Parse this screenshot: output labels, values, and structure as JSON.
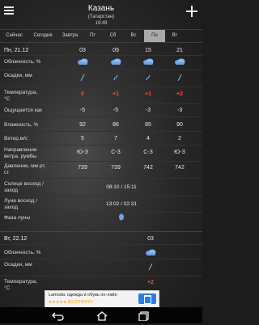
{
  "header": {
    "title": "Казань",
    "subtitle": "(Татарстан)",
    "time": "19:49"
  },
  "tabs": [
    {
      "label": "Сейчас"
    },
    {
      "label": "Сегодня"
    },
    {
      "label": "Завтра"
    },
    {
      "label": "Пт"
    },
    {
      "label": "Сб"
    },
    {
      "label": "Вс"
    },
    {
      "label": "Пн",
      "active": true
    },
    {
      "label": "Вт"
    }
  ],
  "day1": {
    "date": "Пн, 21.12",
    "hours": [
      "03",
      "09",
      "15",
      "21"
    ],
    "labels": {
      "cloudiness": "Облачность, %",
      "precip": "Осадки, мм",
      "temperature": "Температура, °С",
      "feels_like": "Ощущается как",
      "humidity": "Влажность, %",
      "wind": "Ветер,м/с",
      "wind_dir": "Направление ветра, румбы",
      "pressure": "Давление, мм рт. ст.",
      "sun": "Солнце восход / заход",
      "moon": "Луна восход / заход",
      "moon_phase": "Фаза луны"
    },
    "temperature": [
      "0",
      "+1",
      "+1",
      "+2"
    ],
    "feels_like": [
      "-5",
      "-5",
      "-3",
      "-3"
    ],
    "humidity": [
      "92",
      "86",
      "85",
      "90"
    ],
    "wind": [
      "5",
      "7",
      "4",
      "2"
    ],
    "wind_dir": [
      "Ю-З",
      "С-З",
      "С-З",
      "Ю-З"
    ],
    "pressure": [
      "739",
      "739",
      "742",
      "742"
    ],
    "sun": "08:10 / 15:11",
    "moon": "13:02 / 02:31"
  },
  "day2": {
    "date": "Вт, 22.12",
    "hours": [
      "03"
    ],
    "labels": {
      "cloudiness": "Облачность, %",
      "precip": "Осадки, мм",
      "temperature": "Температура, °С"
    },
    "temperature": [
      "+2"
    ]
  },
  "ad": {
    "text": "Lamoda: одежда и обувь он-лайн",
    "rating": "★★★★★ БЕСПЛАТНО"
  },
  "icons": {
    "menu": "hamburger-icon",
    "add": "plus-icon",
    "cloud": "cloud-icon",
    "rain": "rain-icon",
    "moon": "moon-icon",
    "back": "back-icon",
    "home": "home-icon",
    "recent": "recent-apps-icon",
    "ad_open": "open-icon"
  },
  "colors": {
    "accent_red": "#ff4a2a",
    "icon_blue": "#6fa3e6",
    "ad_button": "#2b7de1"
  }
}
